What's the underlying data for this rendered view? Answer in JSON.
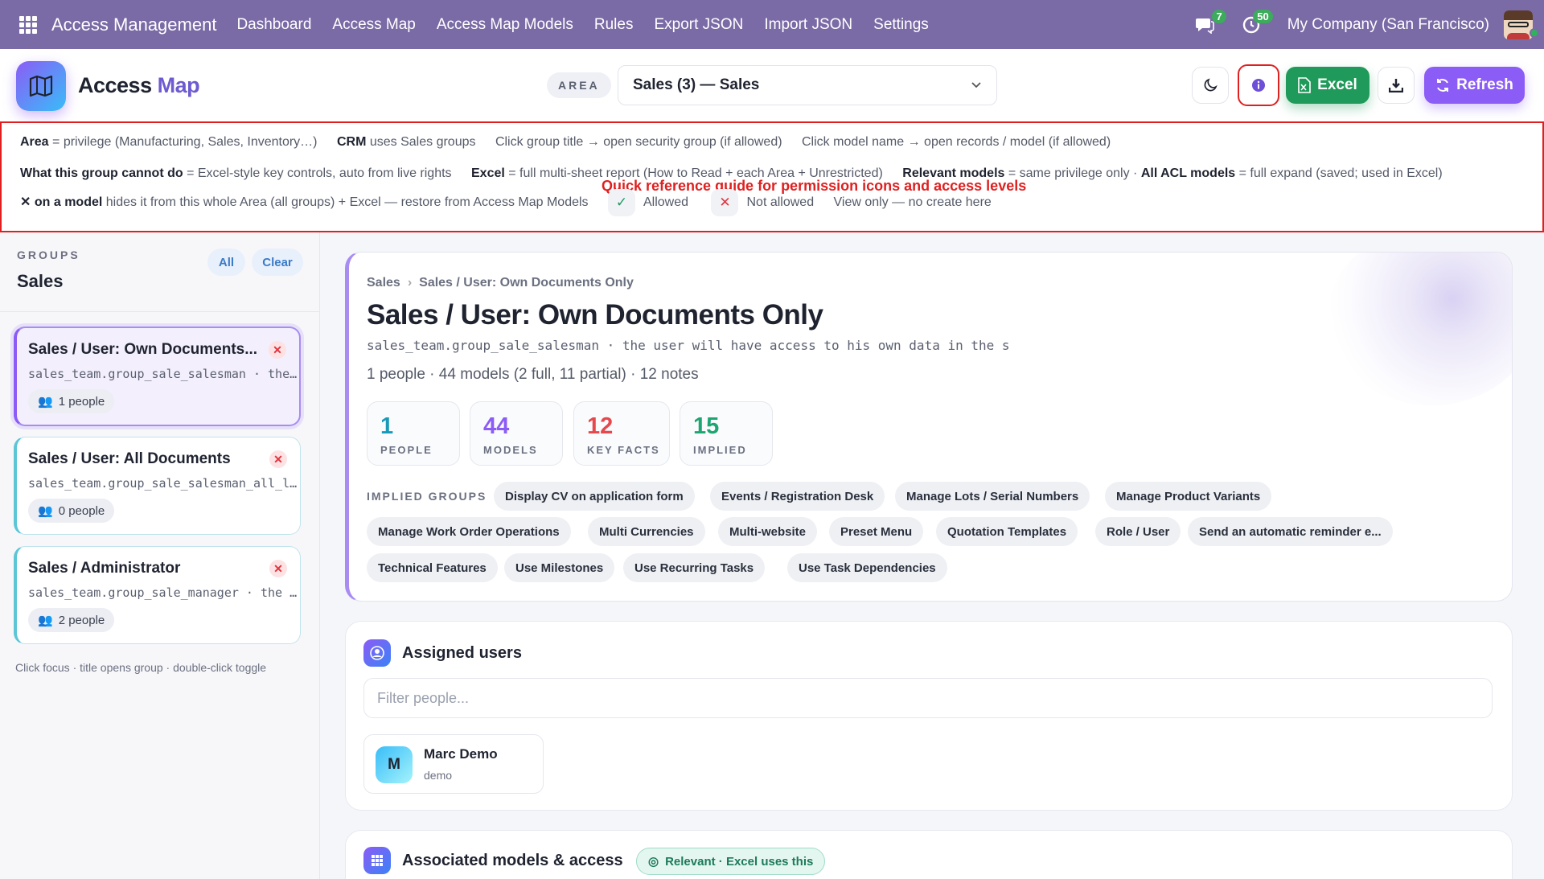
{
  "topbar": {
    "app_name": "Access Management",
    "menu": [
      "Dashboard",
      "Access Map",
      "Access Map Models",
      "Rules",
      "Export JSON",
      "Import JSON",
      "Settings"
    ],
    "messages_count": "7",
    "activities_count": "50",
    "company": "My Company (San Francisco)"
  },
  "header": {
    "title_part1": "Access",
    "title_part2": "Map",
    "area_label": "AREA",
    "area_value": "Sales (3) — Sales",
    "excel_label": "Excel",
    "refresh_label": "Refresh"
  },
  "guide": {
    "line1": [
      {
        "b": "Area",
        "t": " = privilege (Manufacturing, Sales, Inventory…)"
      },
      {
        "b": "CRM",
        "t": " uses Sales groups"
      },
      {
        "b": "",
        "t": "Click group title → open security group (if allowed)"
      },
      {
        "b": "",
        "t": "Click model name → open records / model (if allowed)"
      }
    ],
    "line2": [
      {
        "b": "What this group cannot do",
        "t": " = Excel-style key controls, auto from live rights"
      },
      {
        "b": "Excel",
        "t": " = full multi-sheet report (How to Read + each Area + Unrestricted)"
      },
      {
        "b": "Relevant models",
        "t": " = same privilege only · "
      },
      {
        "b": "All ACL models",
        "t": " = full expand (saved; used in Excel)"
      }
    ],
    "line3_bold": "✕ on a model",
    "line3_text": " hides it from this whole Area (all groups) + Excel — restore from Access Map Models",
    "allowed": "Allowed",
    "not_allowed": "Not allowed",
    "view_only": "View only — no create here",
    "caption": "Quick reference guide for permission icons and access levels"
  },
  "sidebar": {
    "label": "GROUPS",
    "title": "Sales",
    "all_label": "All",
    "clear_label": "Clear",
    "groups": [
      {
        "title": "Sales / User: Own Documents...",
        "tech": "sales_team.group_sale_salesman · the…",
        "people": "1 people",
        "active": true
      },
      {
        "title": "Sales / User: All Documents",
        "tech": "sales_team.group_sale_salesman_all_l…",
        "people": "0 people",
        "active": false
      },
      {
        "title": "Sales / Administrator",
        "tech": "sales_team.group_sale_manager · the …",
        "people": "2 people",
        "active": false
      }
    ],
    "hint": "Click focus · title opens group · double-click toggle"
  },
  "detail": {
    "crumb_root": "Sales",
    "crumb_leaf": "Sales / User: Own Documents Only",
    "title": "Sales / User: Own Documents Only",
    "tech": "sales_team.group_sale_salesman · the user will have access to his own data in the s",
    "summary": "1 people · 44 models (2 full, 11 partial) · 12 notes",
    "stats": [
      {
        "num": "1",
        "label": "PEOPLE",
        "color": "#1a9ab8"
      },
      {
        "num": "44",
        "label": "MODELS",
        "color": "#8b5cf6"
      },
      {
        "num": "12",
        "label": "KEY FACTS",
        "color": "#e5484d"
      },
      {
        "num": "15",
        "label": "IMPLIED",
        "color": "#1ea672"
      }
    ],
    "implied_label": "IMPLIED GROUPS",
    "implied": [
      "Display CV on application form",
      "Events / Registration Desk",
      "Manage Lots / Serial Numbers",
      "Manage Product Variants",
      "Manage Work Order Operations",
      "Multi Currencies",
      "Multi-website",
      "Preset Menu",
      "Quotation Templates",
      "Role / User",
      "Send an automatic reminder e...",
      "Technical Features",
      "Use Milestones",
      "Use Recurring Tasks",
      "Use Task Dependencies"
    ]
  },
  "users": {
    "title": "Assigned users",
    "filter_placeholder": "Filter people...",
    "people": [
      {
        "initial": "M",
        "name": "Marc Demo",
        "login": "demo"
      }
    ]
  },
  "models": {
    "title": "Associated models & access",
    "badge": "Relevant · Excel uses this"
  }
}
